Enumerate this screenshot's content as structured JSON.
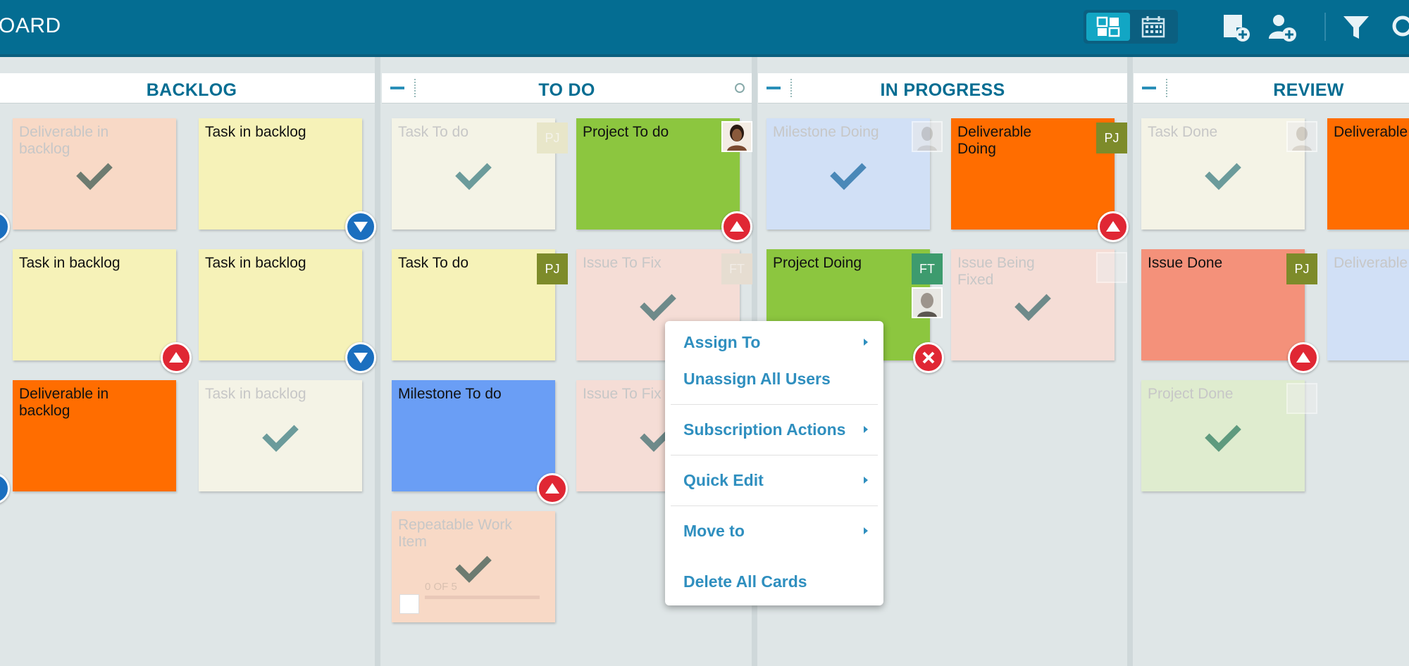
{
  "app": {
    "title": "OARD"
  },
  "colors": {
    "topbar": "#046d92",
    "accent": "#2f8fbf",
    "orange": "#ff6d00",
    "green": "#8cc63f",
    "yellow": "#f6f2b8",
    "peach": "#f5cdb2",
    "salmon": "#f4917a",
    "blue": "#6a9ef5",
    "pj_badge": "#7d8b2a",
    "ft_badge": "#3d9b6e",
    "priority_up": "#e02734",
    "priority_down": "#1b6fbf"
  },
  "toolbar": {
    "icons": [
      "board-view-icon",
      "calendar-view-icon",
      "add-card-icon",
      "add-user-icon",
      "filter-icon",
      "search-icon"
    ]
  },
  "columns": [
    {
      "title": "BACKLOG"
    },
    {
      "title": "TO DO"
    },
    {
      "title": "IN PROGRESS"
    },
    {
      "title": "REVIEW"
    }
  ],
  "cards": {
    "backlog": [
      {
        "title": "Deliverable in backlog"
      },
      {
        "title": "Task in backlog"
      },
      {
        "title": "Task in backlog"
      },
      {
        "title": "Task in backlog"
      },
      {
        "title": "Deliverable in backlog"
      },
      {
        "title": "Task in backlog"
      }
    ],
    "todo": [
      {
        "title": "Task To do",
        "badge": "PJ"
      },
      {
        "title": "Project To do"
      },
      {
        "title": "Task To do",
        "badge": "PJ"
      },
      {
        "title": "Issue To Fix",
        "badge": "FT"
      },
      {
        "title": "Milestone To do"
      },
      {
        "title": "Issue To Fix"
      },
      {
        "title": "Repeatable Work Item",
        "progress": "0 OF 5"
      }
    ],
    "inprogress": [
      {
        "title": "Milestone Doing"
      },
      {
        "title": "Deliverable Doing",
        "badge": "PJ"
      },
      {
        "title": "Project Doing",
        "badge": "FT"
      },
      {
        "title": "Issue Being Fixed"
      }
    ],
    "review": [
      {
        "title": "Task Done"
      },
      {
        "title": "Deliverable"
      },
      {
        "title": "Issue Done",
        "badge": "PJ"
      },
      {
        "title": "Deliverable"
      },
      {
        "title": "Project Done"
      }
    ]
  },
  "context_menu": {
    "items": [
      {
        "label": "Assign To"
      },
      {
        "label": "Unassign All Users"
      },
      {
        "label": "Subscription Actions"
      },
      {
        "label": "Quick Edit"
      },
      {
        "label": "Move to"
      },
      {
        "label": "Delete All Cards"
      }
    ]
  }
}
